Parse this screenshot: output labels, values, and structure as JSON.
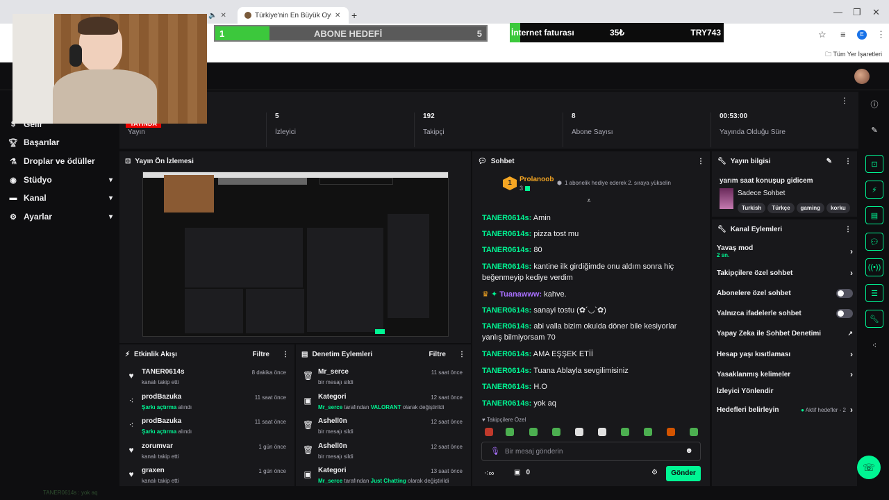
{
  "browser": {
    "tab1_title": "Türkiye'nin En Büyük Oyuncu D",
    "bookmarks_label": "Tüm Yer İşaretleri"
  },
  "overlay": {
    "goal_left_num": "1",
    "goal_title": "ABONE HEDEFİ",
    "goal_right_num": "5",
    "goal_progress": 0.2,
    "bill_label": "İnternet faturası",
    "bill_amount": "35₺",
    "bill_total": "TRY743",
    "bill_progress": 0.05
  },
  "sidebar": {
    "items": [
      {
        "label": "Gelir"
      },
      {
        "label": "Başarılar"
      },
      {
        "label": "Droplar ve ödüller"
      },
      {
        "label": "Stüdyo"
      },
      {
        "label": "Kanal"
      },
      {
        "label": "Ayarlar"
      }
    ]
  },
  "stats": {
    "live_badge": "YAYINDA",
    "stream_label": "Yayın",
    "viewers_value": "5",
    "viewers_label": "İzleyici",
    "followers_value": "192",
    "followers_label": "Takipçi",
    "subs_value": "8",
    "subs_label": "Abone Sayısı",
    "uptime_value": "00:53:00",
    "uptime_label": "Yayında Olduğu Süre"
  },
  "preview": {
    "title": "Yayın Ön İzlemesi"
  },
  "activity": {
    "title": "Etkinlik Akışı",
    "filter": "Filtre",
    "rows": [
      {
        "name": "TANER0614s",
        "sub_plain": "kanalı takip etti",
        "sub_green": "",
        "sub_after": "",
        "time": "8 dakika önce",
        "icon": "heart-icon"
      },
      {
        "name": "prodBazuka",
        "sub_plain": "",
        "sub_green": "Şarkı açtırma",
        "sub_after": " alındı",
        "time": "11 saat önce",
        "icon": "points-icon"
      },
      {
        "name": "prodBazuka",
        "sub_plain": "",
        "sub_green": "Şarkı açtırma",
        "sub_after": " alındı",
        "time": "11 saat önce",
        "icon": "points-icon"
      },
      {
        "name": "zorumvar",
        "sub_plain": "kanalı takip etti",
        "sub_green": "",
        "sub_after": "",
        "time": "1 gün önce",
        "icon": "heart-icon"
      },
      {
        "name": "graxen",
        "sub_plain": "kanalı takip etti",
        "sub_green": "",
        "sub_after": "",
        "time": "1 gün önce",
        "icon": "heart-icon"
      }
    ]
  },
  "moderation": {
    "title": "Denetim Eylemleri",
    "filter": "Filtre",
    "rows": [
      {
        "name": "Mr_serce",
        "sub_plain": "bir mesajı sildi",
        "time": "11 saat önce",
        "icon": "trash-icon"
      },
      {
        "name": "Kategori",
        "sub_g1": "Mr_serce",
        "sub_mid": " tarafından ",
        "sub_g2": "VALORANT",
        "sub_end": " olarak değiştirildi",
        "time": "12 saat önce",
        "icon": "category-icon"
      },
      {
        "name": "Ashell0n",
        "sub_plain": "bir mesajı sildi",
        "time": "12 saat önce",
        "icon": "trash-icon"
      },
      {
        "name": "Ashell0n",
        "sub_plain": "bir mesajı sildi",
        "time": "12 saat önce",
        "icon": "trash-icon"
      },
      {
        "name": "Kategori",
        "sub_g1": "Mr_serce",
        "sub_mid": " tarafından ",
        "sub_g2": "Just Chatting",
        "sub_end": " olarak değiştirildi",
        "time": "13 saat önce",
        "icon": "category-icon"
      }
    ]
  },
  "chat": {
    "title": "Sohbet",
    "pinned_user": "Prolanoob",
    "pinned_rank": "1",
    "pinned_count": "3",
    "pinned_text": "1 abonelik hediye ederek 2. sıraya yükselin",
    "messages": [
      {
        "user": "TANER0614s",
        "text": "Amin"
      },
      {
        "user": "TANER0614s",
        "text": "pizza tost mu"
      },
      {
        "user": "TANER0614s",
        "text": "80"
      },
      {
        "user": "TANER0614s",
        "text": "kantine ilk girdiğimde onu aldım sonra hiç beğenmeyip kediye verdim"
      },
      {
        "user": "Tuanawww",
        "text": "kahve."
      },
      {
        "user": "TANER0614s",
        "text": "sanayi tostu (✿´◡`✿)"
      },
      {
        "user": "TANER0614s",
        "text": "abi valla bizim okulda döner bile kesiyorlar yanlış bilmiyorsam 70"
      },
      {
        "user": "TANER0614s",
        "text": "AMA EŞŞEK ETİİ"
      },
      {
        "user": "TANER0614s",
        "text": "Tuana Ablayla sevgilimisiniz"
      },
      {
        "user": "TANER0614s",
        "text": "H.O"
      },
      {
        "user": "TANER0614s",
        "text": "yok aq"
      }
    ],
    "followers_only": "Takipçilere Özel",
    "input_placeholder": "Bir mesaj gönderin",
    "points": "0",
    "send_label": "Gönder"
  },
  "stream_info": {
    "title": "Yayın bilgisi",
    "stream_title": "yarım saat konuşup gidicem",
    "category": "Sadece Sohbet",
    "tags": [
      "Turkish",
      "Türkçe",
      "gaming",
      "korku"
    ]
  },
  "channel_actions": {
    "title": "Kanal Eylemleri",
    "slow_mode": "Yavaş mod",
    "slow_mode_value": "2 sn.",
    "followers_chat": "Takipçilere özel sohbet",
    "subs_chat": "Abonelere özel sohbet",
    "emote_chat": "Yalnızca ifadelerle sohbet",
    "ai_mod": "Yapay Zeka ile Sohbet Denetimi",
    "age_restrict": "Hesap yaşı kısıtlaması",
    "banned_words": "Yasaklanmış kelimeler",
    "redirect": "İzleyici Yönlendir",
    "goals": "Hedefleri belirleyin",
    "goals_active": "Aktif hedefler - 2"
  },
  "footer": {
    "text": "TANER0614s : yok aq"
  }
}
